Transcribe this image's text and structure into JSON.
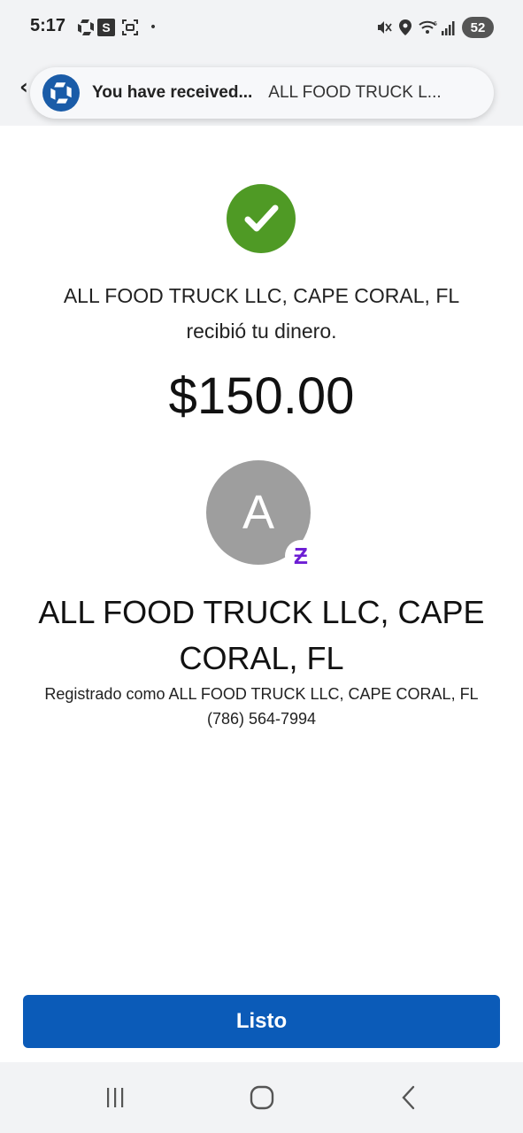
{
  "status_bar": {
    "time": "5:17",
    "s_icon": "S",
    "dot": "•",
    "battery": "52",
    "icons": [
      "chase-icon",
      "s-app-icon",
      "screenshot-icon",
      "mute-icon",
      "location-icon",
      "wifi-icon",
      "signal-icon",
      "battery-icon"
    ]
  },
  "notification": {
    "title": "You have received...",
    "subtitle": "ALL FOOD TRUCK L..."
  },
  "confirmation": {
    "message_line1": "ALL FOOD TRUCK LLC, CAPE CORAL, FL",
    "message_line2": "recibió tu dinero.",
    "amount": "$150.00"
  },
  "recipient": {
    "avatar_letter": "A",
    "zelle_badge": "Ƶ",
    "name": "ALL FOOD TRUCK LLC, CAPE CORAL, FL",
    "registered_as": "Registrado como ALL FOOD TRUCK LLC, CAPE CORAL, FL",
    "phone": "(786) 564-7994"
  },
  "actions": {
    "done_label": "Listo"
  },
  "colors": {
    "success_green": "#4f9a25",
    "primary_blue": "#0b5bb8",
    "zelle_purple": "#6d1ed4",
    "avatar_gray": "#9e9e9e"
  }
}
